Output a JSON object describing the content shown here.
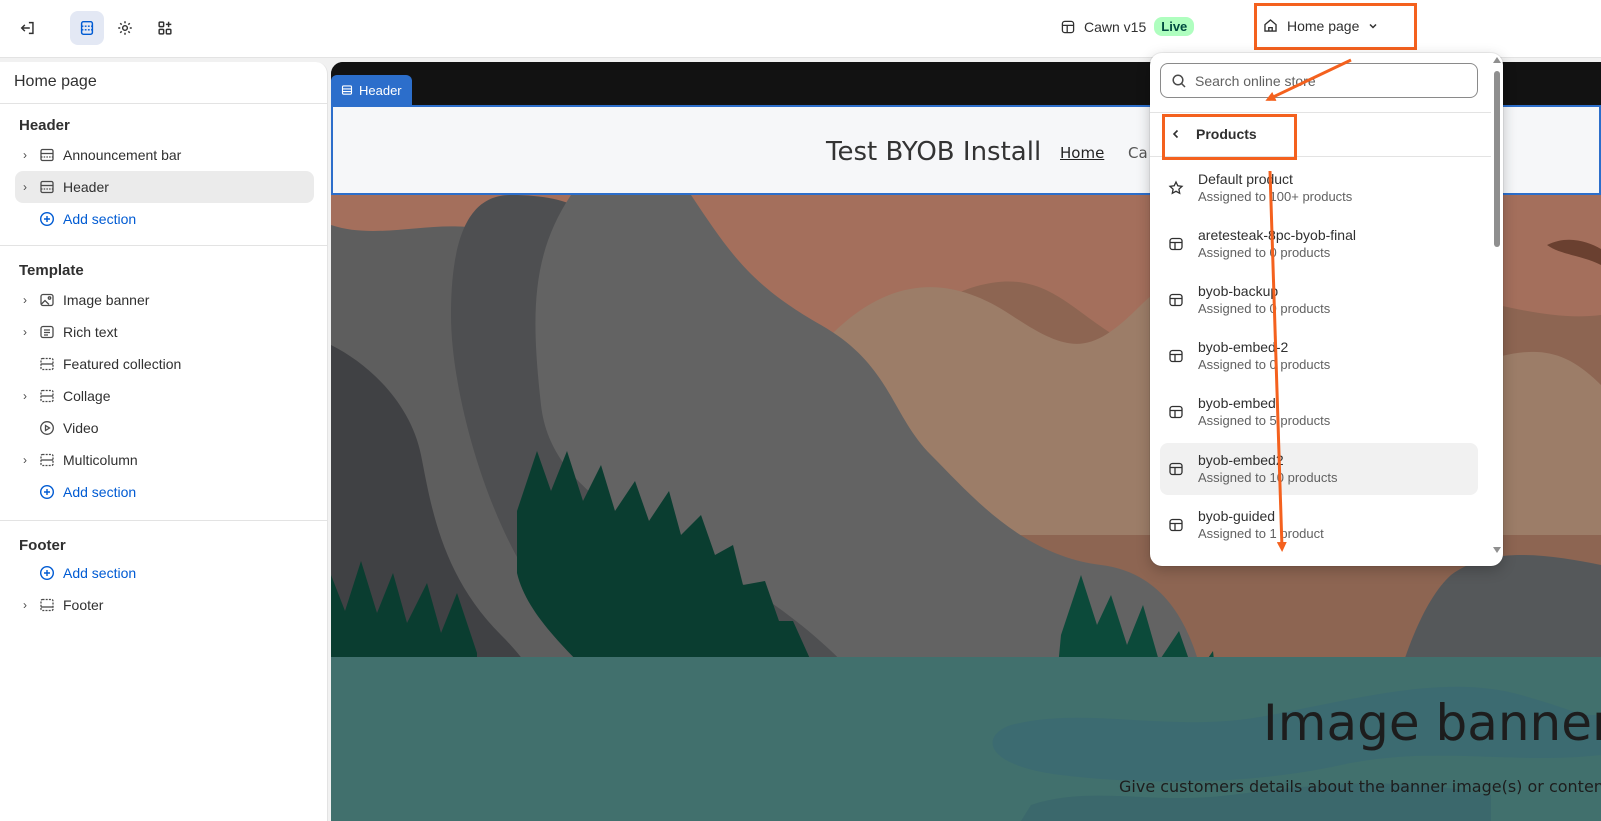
{
  "topbar": {
    "exit_icon": "exit-icon",
    "tool_icons": [
      "sections-icon",
      "gear-icon",
      "apps-icon"
    ],
    "theme_icon": "layout-icon",
    "theme_name": "Cawn v15",
    "live_badge": "Live",
    "page_selector": "Home page"
  },
  "sidebar": {
    "title": "Home page",
    "groups": [
      {
        "label": "Header",
        "items": [
          "Announcement bar",
          "Header"
        ],
        "add": "Add section"
      },
      {
        "label": "Template",
        "items": [
          "Image banner",
          "Rich text",
          "Featured collection",
          "Collage",
          "Video",
          "Multicolumn"
        ],
        "add": "Add section"
      },
      {
        "label": "Footer",
        "items": [
          "Footer"
        ],
        "add": "Add section"
      }
    ]
  },
  "preview": {
    "header_tag": "Header",
    "store_name": "Test BYOB Install",
    "nav": [
      "Home",
      "Ca"
    ],
    "banner_title": "Image banner",
    "banner_subtitle": "Give customers details about the banner image(s) or content",
    "colors": {
      "selection": "#2c6ecb",
      "water": "#41706d",
      "forest": "#0c3a2d"
    }
  },
  "popover": {
    "search_placeholder": "Search online store",
    "back_label": "Products",
    "items": [
      {
        "name": "Default product",
        "meta": "Assigned to 100+ products",
        "icon": "star-icon"
      },
      {
        "name": "aretesteak-8pc-byob-final",
        "meta": "Assigned to 0 products",
        "icon": "template-icon"
      },
      {
        "name": "byob-backup",
        "meta": "Assigned to 0 products",
        "icon": "template-icon"
      },
      {
        "name": "byob-embed-2",
        "meta": "Assigned to 0 products",
        "icon": "template-icon"
      },
      {
        "name": "byob-embed",
        "meta": "Assigned to 5 products",
        "icon": "template-icon"
      },
      {
        "name": "byob-embed2",
        "meta": "Assigned to 10 products",
        "icon": "template-icon"
      },
      {
        "name": "byob-guided",
        "meta": "Assigned to 1 product",
        "icon": "template-icon"
      }
    ]
  },
  "annotation_color": "#f4611e"
}
